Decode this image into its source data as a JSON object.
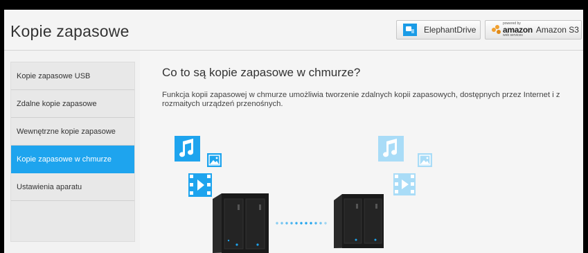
{
  "header": {
    "title": "Kopie zapasowe",
    "providers": [
      {
        "label": "ElephantDrive",
        "icon": "elephantdrive-logo-icon"
      },
      {
        "label": "Amazon S3",
        "icon": "amazon-logo-icon",
        "logo_text": "amazon",
        "logo_powered": "powered by",
        "logo_sub": "web services"
      }
    ]
  },
  "sidebar": {
    "items": [
      {
        "label": "Kopie zapasowe USB",
        "active": false
      },
      {
        "label": "Zdalne kopie zapasowe",
        "active": false
      },
      {
        "label": "Wewnętrzne kopie zapasowe",
        "active": false
      },
      {
        "label": "Kopie zapasowe w chmurze",
        "active": true
      },
      {
        "label": "Ustawienia aparatu",
        "active": false
      }
    ]
  },
  "main": {
    "title": "Co to są kopie zapasowe w chmurze?",
    "description": "Funkcja kopii zapasowej w chmurze umożliwia tworzenie zdalnych kopii zapasowych, dostępnych przez Internet i z rozmaitych urządzeń przenośnych."
  },
  "colors": {
    "accent": "#1ea4ee",
    "accent_light": "#a9dcf7",
    "nas_body": "#1c1c1c"
  }
}
